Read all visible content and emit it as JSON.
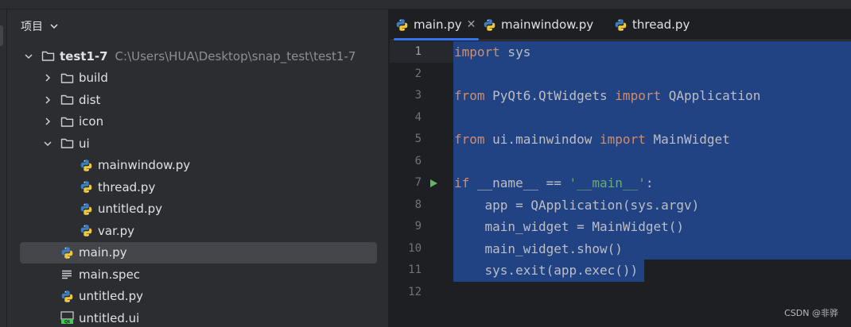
{
  "project_panel": {
    "title": "项目",
    "tree": [
      {
        "label": "test1-7",
        "path": "C:\\Users\\HUA\\Desktop\\snap_test\\test1-7",
        "kind": "folder",
        "arrow": "down",
        "depth": 0,
        "bold": true
      },
      {
        "label": "build",
        "kind": "folder",
        "arrow": "right",
        "depth": 1
      },
      {
        "label": "dist",
        "kind": "folder",
        "arrow": "right",
        "depth": 1
      },
      {
        "label": "icon",
        "kind": "folder",
        "arrow": "right",
        "depth": 1
      },
      {
        "label": "ui",
        "kind": "folder",
        "arrow": "down",
        "depth": 1
      },
      {
        "label": "mainwindow.py",
        "kind": "python",
        "depth": 2
      },
      {
        "label": "thread.py",
        "kind": "python",
        "depth": 2
      },
      {
        "label": "untitled.py",
        "kind": "python",
        "depth": 2
      },
      {
        "label": "var.py",
        "kind": "python",
        "depth": 2
      },
      {
        "label": "main.py",
        "kind": "python",
        "depth": 1,
        "selected": true
      },
      {
        "label": "main.spec",
        "kind": "text",
        "depth": 1
      },
      {
        "label": "untitled.py",
        "kind": "python",
        "depth": 1
      },
      {
        "label": "untitled.ui",
        "kind": "qt-ui",
        "depth": 1
      }
    ]
  },
  "editor": {
    "tabs": [
      {
        "label": "main.py",
        "active": true,
        "closable": true
      },
      {
        "label": "mainwindow.py",
        "active": false
      },
      {
        "label": "thread.py",
        "active": false
      }
    ],
    "code_lines": [
      [
        {
          "t": "import",
          "c": "kw"
        },
        {
          "t": " sys"
        }
      ],
      [],
      [
        {
          "t": "from",
          "c": "kw"
        },
        {
          "t": " PyQt6.QtWidgets "
        },
        {
          "t": "import",
          "c": "kw"
        },
        {
          "t": " QApplication"
        }
      ],
      [],
      [
        {
          "t": "from",
          "c": "kw"
        },
        {
          "t": " ui.mainwindow "
        },
        {
          "t": "import",
          "c": "kw"
        },
        {
          "t": " MainWidget"
        }
      ],
      [],
      [
        {
          "t": "if",
          "c": "kw"
        },
        {
          "t": " __name__ == "
        },
        {
          "t": "'__main__'",
          "c": "str"
        },
        {
          "t": ":"
        }
      ],
      [
        {
          "t": "    app = QApplication(sys.argv)"
        }
      ],
      [
        {
          "t": "    main_widget = MainWidget()"
        }
      ],
      [
        {
          "t": "    main_widget.show()"
        }
      ],
      [
        {
          "t": "    sys.exit(app.exec())"
        }
      ],
      []
    ],
    "current_line": 1,
    "run_gutter_line": 7
  },
  "watermark": "CSDN @非骅",
  "colors": {
    "keyword": "#cf8e6d",
    "string": "#6aab73",
    "selection": "#214283",
    "tab_underline": "#3574f0",
    "run_icon": "#5fb865"
  },
  "icons": {
    "folder": "folder-icon",
    "python": "python-file-icon",
    "text": "text-file-icon",
    "qt-ui": "qt-ui-file-icon",
    "run": "run-icon"
  }
}
